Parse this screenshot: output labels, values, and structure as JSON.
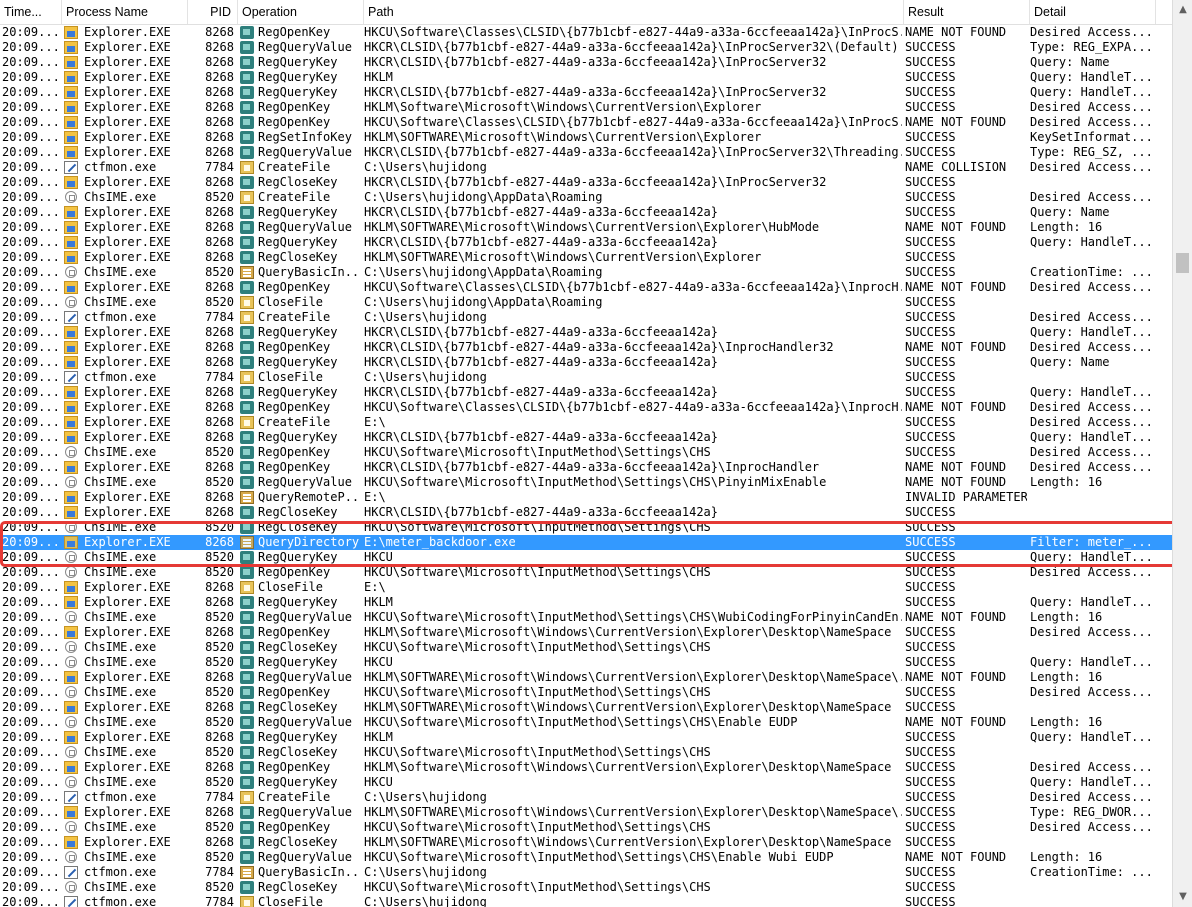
{
  "columns": {
    "time": "Time...",
    "process": "Process Name",
    "pid": "PID",
    "operation": "Operation",
    "path": "Path",
    "result": "Result",
    "detail": "Detail"
  },
  "rows": [
    {
      "time": "20:09...",
      "proc": "Explorer.EXE",
      "pid": "8268",
      "op": "RegOpenKey",
      "path": "HKCU\\Software\\Classes\\CLSID\\{b77b1cbf-e827-44a9-a33a-6ccfeeaa142a}\\InProcS...",
      "result": "NAME NOT FOUND",
      "detail": "Desired Access..."
    },
    {
      "time": "20:09...",
      "proc": "Explorer.EXE",
      "pid": "8268",
      "op": "RegQueryValue",
      "path": "HKCR\\CLSID\\{b77b1cbf-e827-44a9-a33a-6ccfeeaa142a}\\InProcServer32\\(Default)",
      "result": "SUCCESS",
      "detail": "Type: REG_EXPA..."
    },
    {
      "time": "20:09...",
      "proc": "Explorer.EXE",
      "pid": "8268",
      "op": "RegQueryKey",
      "path": "HKCR\\CLSID\\{b77b1cbf-e827-44a9-a33a-6ccfeeaa142a}\\InProcServer32",
      "result": "SUCCESS",
      "detail": "Query: Name"
    },
    {
      "time": "20:09...",
      "proc": "Explorer.EXE",
      "pid": "8268",
      "op": "RegQueryKey",
      "path": "HKLM",
      "result": "SUCCESS",
      "detail": "Query: HandleT..."
    },
    {
      "time": "20:09...",
      "proc": "Explorer.EXE",
      "pid": "8268",
      "op": "RegQueryKey",
      "path": "HKCR\\CLSID\\{b77b1cbf-e827-44a9-a33a-6ccfeeaa142a}\\InProcServer32",
      "result": "SUCCESS",
      "detail": "Query: HandleT..."
    },
    {
      "time": "20:09...",
      "proc": "Explorer.EXE",
      "pid": "8268",
      "op": "RegOpenKey",
      "path": "HKLM\\Software\\Microsoft\\Windows\\CurrentVersion\\Explorer",
      "result": "SUCCESS",
      "detail": "Desired Access..."
    },
    {
      "time": "20:09...",
      "proc": "Explorer.EXE",
      "pid": "8268",
      "op": "RegOpenKey",
      "path": "HKCU\\Software\\Classes\\CLSID\\{b77b1cbf-e827-44a9-a33a-6ccfeeaa142a}\\InProcS...",
      "result": "NAME NOT FOUND",
      "detail": "Desired Access..."
    },
    {
      "time": "20:09...",
      "proc": "Explorer.EXE",
      "pid": "8268",
      "op": "RegSetInfoKey",
      "path": "HKLM\\SOFTWARE\\Microsoft\\Windows\\CurrentVersion\\Explorer",
      "result": "SUCCESS",
      "detail": "KeySetInformat..."
    },
    {
      "time": "20:09...",
      "proc": "Explorer.EXE",
      "pid": "8268",
      "op": "RegQueryValue",
      "path": "HKCR\\CLSID\\{b77b1cbf-e827-44a9-a33a-6ccfeeaa142a}\\InProcServer32\\Threading...",
      "result": "SUCCESS",
      "detail": "Type: REG_SZ, ..."
    },
    {
      "time": "20:09...",
      "proc": "ctfmon.exe",
      "pid": "7784",
      "op": "CreateFile",
      "path": "C:\\Users\\hujidong",
      "result": "NAME COLLISION",
      "detail": "Desired Access..."
    },
    {
      "time": "20:09...",
      "proc": "Explorer.EXE",
      "pid": "8268",
      "op": "RegCloseKey",
      "path": "HKCR\\CLSID\\{b77b1cbf-e827-44a9-a33a-6ccfeeaa142a}\\InProcServer32",
      "result": "SUCCESS",
      "detail": ""
    },
    {
      "time": "20:09...",
      "proc": "ChsIME.exe",
      "pid": "8520",
      "op": "CreateFile",
      "path": "C:\\Users\\hujidong\\AppData\\Roaming",
      "result": "SUCCESS",
      "detail": "Desired Access..."
    },
    {
      "time": "20:09...",
      "proc": "Explorer.EXE",
      "pid": "8268",
      "op": "RegQueryKey",
      "path": "HKCR\\CLSID\\{b77b1cbf-e827-44a9-a33a-6ccfeeaa142a}",
      "result": "SUCCESS",
      "detail": "Query: Name"
    },
    {
      "time": "20:09...",
      "proc": "Explorer.EXE",
      "pid": "8268",
      "op": "RegQueryValue",
      "path": "HKLM\\SOFTWARE\\Microsoft\\Windows\\CurrentVersion\\Explorer\\HubMode",
      "result": "NAME NOT FOUND",
      "detail": "Length: 16"
    },
    {
      "time": "20:09...",
      "proc": "Explorer.EXE",
      "pid": "8268",
      "op": "RegQueryKey",
      "path": "HKCR\\CLSID\\{b77b1cbf-e827-44a9-a33a-6ccfeeaa142a}",
      "result": "SUCCESS",
      "detail": "Query: HandleT..."
    },
    {
      "time": "20:09...",
      "proc": "Explorer.EXE",
      "pid": "8268",
      "op": "RegCloseKey",
      "path": "HKLM\\SOFTWARE\\Microsoft\\Windows\\CurrentVersion\\Explorer",
      "result": "SUCCESS",
      "detail": ""
    },
    {
      "time": "20:09...",
      "proc": "ChsIME.exe",
      "pid": "8520",
      "op": "QueryBasicIn...",
      "path": "C:\\Users\\hujidong\\AppData\\Roaming",
      "result": "SUCCESS",
      "detail": "CreationTime: ..."
    },
    {
      "time": "20:09...",
      "proc": "Explorer.EXE",
      "pid": "8268",
      "op": "RegOpenKey",
      "path": "HKCU\\Software\\Classes\\CLSID\\{b77b1cbf-e827-44a9-a33a-6ccfeeaa142a}\\InprocH...",
      "result": "NAME NOT FOUND",
      "detail": "Desired Access..."
    },
    {
      "time": "20:09...",
      "proc": "ChsIME.exe",
      "pid": "8520",
      "op": "CloseFile",
      "path": "C:\\Users\\hujidong\\AppData\\Roaming",
      "result": "SUCCESS",
      "detail": ""
    },
    {
      "time": "20:09...",
      "proc": "ctfmon.exe",
      "pid": "7784",
      "op": "CreateFile",
      "path": "C:\\Users\\hujidong",
      "result": "SUCCESS",
      "detail": "Desired Access..."
    },
    {
      "time": "20:09...",
      "proc": "Explorer.EXE",
      "pid": "8268",
      "op": "RegQueryKey",
      "path": "HKCR\\CLSID\\{b77b1cbf-e827-44a9-a33a-6ccfeeaa142a}",
      "result": "SUCCESS",
      "detail": "Query: HandleT..."
    },
    {
      "time": "20:09...",
      "proc": "Explorer.EXE",
      "pid": "8268",
      "op": "RegOpenKey",
      "path": "HKCR\\CLSID\\{b77b1cbf-e827-44a9-a33a-6ccfeeaa142a}\\InprocHandler32",
      "result": "NAME NOT FOUND",
      "detail": "Desired Access..."
    },
    {
      "time": "20:09...",
      "proc": "Explorer.EXE",
      "pid": "8268",
      "op": "RegQueryKey",
      "path": "HKCR\\CLSID\\{b77b1cbf-e827-44a9-a33a-6ccfeeaa142a}",
      "result": "SUCCESS",
      "detail": "Query: Name"
    },
    {
      "time": "20:09...",
      "proc": "ctfmon.exe",
      "pid": "7784",
      "op": "CloseFile",
      "path": "C:\\Users\\hujidong",
      "result": "SUCCESS",
      "detail": ""
    },
    {
      "time": "20:09...",
      "proc": "Explorer.EXE",
      "pid": "8268",
      "op": "RegQueryKey",
      "path": "HKCR\\CLSID\\{b77b1cbf-e827-44a9-a33a-6ccfeeaa142a}",
      "result": "SUCCESS",
      "detail": "Query: HandleT..."
    },
    {
      "time": "20:09...",
      "proc": "Explorer.EXE",
      "pid": "8268",
      "op": "RegOpenKey",
      "path": "HKCU\\Software\\Classes\\CLSID\\{b77b1cbf-e827-44a9-a33a-6ccfeeaa142a}\\InprocH...",
      "result": "NAME NOT FOUND",
      "detail": "Desired Access..."
    },
    {
      "time": "20:09...",
      "proc": "Explorer.EXE",
      "pid": "8268",
      "op": "CreateFile",
      "path": "E:\\",
      "result": "SUCCESS",
      "detail": "Desired Access..."
    },
    {
      "time": "20:09...",
      "proc": "Explorer.EXE",
      "pid": "8268",
      "op": "RegQueryKey",
      "path": "HKCR\\CLSID\\{b77b1cbf-e827-44a9-a33a-6ccfeeaa142a}",
      "result": "SUCCESS",
      "detail": "Query: HandleT..."
    },
    {
      "time": "20:09...",
      "proc": "ChsIME.exe",
      "pid": "8520",
      "op": "RegOpenKey",
      "path": "HKCU\\Software\\Microsoft\\InputMethod\\Settings\\CHS",
      "result": "SUCCESS",
      "detail": "Desired Access..."
    },
    {
      "time": "20:09...",
      "proc": "Explorer.EXE",
      "pid": "8268",
      "op": "RegOpenKey",
      "path": "HKCR\\CLSID\\{b77b1cbf-e827-44a9-a33a-6ccfeeaa142a}\\InprocHandler",
      "result": "NAME NOT FOUND",
      "detail": "Desired Access..."
    },
    {
      "time": "20:09...",
      "proc": "ChsIME.exe",
      "pid": "8520",
      "op": "RegQueryValue",
      "path": "HKCU\\Software\\Microsoft\\InputMethod\\Settings\\CHS\\PinyinMixEnable",
      "result": "NAME NOT FOUND",
      "detail": "Length: 16"
    },
    {
      "time": "20:09...",
      "proc": "Explorer.EXE",
      "pid": "8268",
      "op": "QueryRemoteP...",
      "path": "E:\\",
      "result": "INVALID PARAMETER",
      "detail": ""
    },
    {
      "time": "20:09...",
      "proc": "Explorer.EXE",
      "pid": "8268",
      "op": "RegCloseKey",
      "path": "HKCR\\CLSID\\{b77b1cbf-e827-44a9-a33a-6ccfeeaa142a}",
      "result": "SUCCESS",
      "detail": ""
    },
    {
      "time": "20:09...",
      "proc": "ChsIME.exe",
      "pid": "8520",
      "op": "RegCloseKey",
      "path": "HKCU\\Software\\Microsoft\\InputMethod\\Settings\\CHS",
      "result": "SUCCESS",
      "detail": ""
    },
    {
      "time": "20:09...",
      "proc": "Explorer.EXE",
      "pid": "8268",
      "op": "QueryDirectory",
      "path": "E:\\meter_backdoor.exe",
      "result": "SUCCESS",
      "detail": "Filter: meter_...",
      "selected": true
    },
    {
      "time": "20:09...",
      "proc": "ChsIME.exe",
      "pid": "8520",
      "op": "RegQueryKey",
      "path": "HKCU",
      "result": "SUCCESS",
      "detail": "Query: HandleT..."
    },
    {
      "time": "20:09...",
      "proc": "ChsIME.exe",
      "pid": "8520",
      "op": "RegOpenKey",
      "path": "HKCU\\Software\\Microsoft\\InputMethod\\Settings\\CHS",
      "result": "SUCCESS",
      "detail": "Desired Access..."
    },
    {
      "time": "20:09...",
      "proc": "Explorer.EXE",
      "pid": "8268",
      "op": "CloseFile",
      "path": "E:\\",
      "result": "SUCCESS",
      "detail": ""
    },
    {
      "time": "20:09...",
      "proc": "Explorer.EXE",
      "pid": "8268",
      "op": "RegQueryKey",
      "path": "HKLM",
      "result": "SUCCESS",
      "detail": "Query: HandleT..."
    },
    {
      "time": "20:09...",
      "proc": "ChsIME.exe",
      "pid": "8520",
      "op": "RegQueryValue",
      "path": "HKCU\\Software\\Microsoft\\InputMethod\\Settings\\CHS\\WubiCodingForPinyinCandEn...",
      "result": "NAME NOT FOUND",
      "detail": "Length: 16"
    },
    {
      "time": "20:09...",
      "proc": "Explorer.EXE",
      "pid": "8268",
      "op": "RegOpenKey",
      "path": "HKLM\\Software\\Microsoft\\Windows\\CurrentVersion\\Explorer\\Desktop\\NameSpace",
      "result": "SUCCESS",
      "detail": "Desired Access..."
    },
    {
      "time": "20:09...",
      "proc": "ChsIME.exe",
      "pid": "8520",
      "op": "RegCloseKey",
      "path": "HKCU\\Software\\Microsoft\\InputMethod\\Settings\\CHS",
      "result": "SUCCESS",
      "detail": ""
    },
    {
      "time": "20:09...",
      "proc": "ChsIME.exe",
      "pid": "8520",
      "op": "RegQueryKey",
      "path": "HKCU",
      "result": "SUCCESS",
      "detail": "Query: HandleT..."
    },
    {
      "time": "20:09...",
      "proc": "Explorer.EXE",
      "pid": "8268",
      "op": "RegQueryValue",
      "path": "HKLM\\SOFTWARE\\Microsoft\\Windows\\CurrentVersion\\Explorer\\Desktop\\NameSpace\\...",
      "result": "NAME NOT FOUND",
      "detail": "Length: 16"
    },
    {
      "time": "20:09...",
      "proc": "ChsIME.exe",
      "pid": "8520",
      "op": "RegOpenKey",
      "path": "HKCU\\Software\\Microsoft\\InputMethod\\Settings\\CHS",
      "result": "SUCCESS",
      "detail": "Desired Access..."
    },
    {
      "time": "20:09...",
      "proc": "Explorer.EXE",
      "pid": "8268",
      "op": "RegCloseKey",
      "path": "HKLM\\SOFTWARE\\Microsoft\\Windows\\CurrentVersion\\Explorer\\Desktop\\NameSpace",
      "result": "SUCCESS",
      "detail": ""
    },
    {
      "time": "20:09...",
      "proc": "ChsIME.exe",
      "pid": "8520",
      "op": "RegQueryValue",
      "path": "HKCU\\Software\\Microsoft\\InputMethod\\Settings\\CHS\\Enable EUDP",
      "result": "NAME NOT FOUND",
      "detail": "Length: 16"
    },
    {
      "time": "20:09...",
      "proc": "Explorer.EXE",
      "pid": "8268",
      "op": "RegQueryKey",
      "path": "HKLM",
      "result": "SUCCESS",
      "detail": "Query: HandleT..."
    },
    {
      "time": "20:09...",
      "proc": "ChsIME.exe",
      "pid": "8520",
      "op": "RegCloseKey",
      "path": "HKCU\\Software\\Microsoft\\InputMethod\\Settings\\CHS",
      "result": "SUCCESS",
      "detail": ""
    },
    {
      "time": "20:09...",
      "proc": "Explorer.EXE",
      "pid": "8268",
      "op": "RegOpenKey",
      "path": "HKLM\\Software\\Microsoft\\Windows\\CurrentVersion\\Explorer\\Desktop\\NameSpace",
      "result": "SUCCESS",
      "detail": "Desired Access..."
    },
    {
      "time": "20:09...",
      "proc": "ChsIME.exe",
      "pid": "8520",
      "op": "RegQueryKey",
      "path": "HKCU",
      "result": "SUCCESS",
      "detail": "Query: HandleT..."
    },
    {
      "time": "20:09...",
      "proc": "ctfmon.exe",
      "pid": "7784",
      "op": "CreateFile",
      "path": "C:\\Users\\hujidong",
      "result": "SUCCESS",
      "detail": "Desired Access..."
    },
    {
      "time": "20:09...",
      "proc": "Explorer.EXE",
      "pid": "8268",
      "op": "RegQueryValue",
      "path": "HKLM\\SOFTWARE\\Microsoft\\Windows\\CurrentVersion\\Explorer\\Desktop\\NameSpace\\...",
      "result": "SUCCESS",
      "detail": "Type: REG_DWOR..."
    },
    {
      "time": "20:09...",
      "proc": "ChsIME.exe",
      "pid": "8520",
      "op": "RegOpenKey",
      "path": "HKCU\\Software\\Microsoft\\InputMethod\\Settings\\CHS",
      "result": "SUCCESS",
      "detail": "Desired Access..."
    },
    {
      "time": "20:09...",
      "proc": "Explorer.EXE",
      "pid": "8268",
      "op": "RegCloseKey",
      "path": "HKLM\\SOFTWARE\\Microsoft\\Windows\\CurrentVersion\\Explorer\\Desktop\\NameSpace",
      "result": "SUCCESS",
      "detail": ""
    },
    {
      "time": "20:09...",
      "proc": "ChsIME.exe",
      "pid": "8520",
      "op": "RegQueryValue",
      "path": "HKCU\\Software\\Microsoft\\InputMethod\\Settings\\CHS\\Enable Wubi EUDP",
      "result": "NAME NOT FOUND",
      "detail": "Length: 16"
    },
    {
      "time": "20:09...",
      "proc": "ctfmon.exe",
      "pid": "7784",
      "op": "QueryBasicIn...",
      "path": "C:\\Users\\hujidong",
      "result": "SUCCESS",
      "detail": "CreationTime: ..."
    },
    {
      "time": "20:09...",
      "proc": "ChsIME.exe",
      "pid": "8520",
      "op": "RegCloseKey",
      "path": "HKCU\\Software\\Microsoft\\InputMethod\\Settings\\CHS",
      "result": "SUCCESS",
      "detail": ""
    },
    {
      "time": "20:09...",
      "proc": "ctfmon.exe",
      "pid": "7784",
      "op": "CloseFile",
      "path": "C:\\Users\\hujidong",
      "result": "SUCCESS",
      "detail": ""
    }
  ],
  "icons": {
    "process": {
      "Explorer.EXE": "explorer-icon",
      "ChsIME.exe": "ime-icon",
      "ctfmon.exe": "ctfmon-icon"
    },
    "operation": {
      "registry": "registry-icon",
      "file": "file-icon",
      "file_meta": "file-query-icon"
    }
  },
  "colors": {
    "selection": "#3399ff",
    "highlight_box": "#e53935"
  }
}
